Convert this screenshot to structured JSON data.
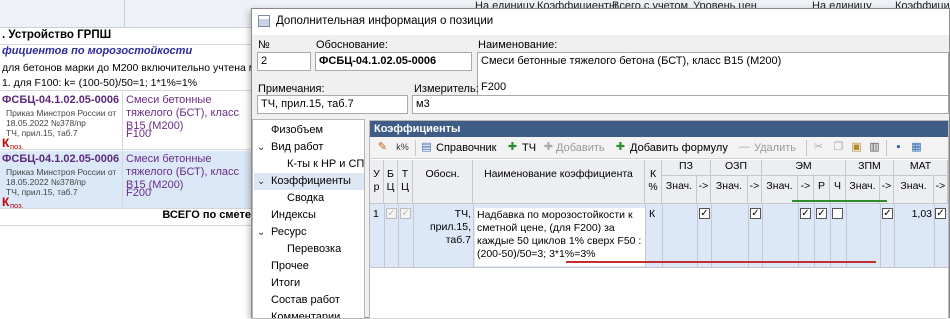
{
  "background": {
    "header_cols": [
      "На единицу",
      "Коэффициенты",
      "Всего с учетом",
      "Уровень цен",
      "На единицу",
      "Коэффициенты"
    ],
    "section_title": ". Устройство ГРПШ",
    "subsection_title": "фициентов по морозостойкости",
    "note_line1": "для бетонов марки до М200 включительно учтена мор",
    "note_line2": "1. для F100: k= (100-50)/50=1; 1*1%=1%",
    "positions": [
      {
        "code": "ФСБЦ-04.1.02.05-0006",
        "order": "Приказ Минстроя России от 18.05.2022 №378/пр",
        "tch": "ТЧ, прил.15, таб.7",
        "k": "К",
        "kpoz": "поз.",
        "name": "Смеси бетонные тяжелого (БСТ), класс B15 (М200)",
        "frost": "F100"
      },
      {
        "code": "ФСБЦ-04.1.02.05-0006",
        "order": "Приказ Минстроя России от 18.05.2022 №378/пр",
        "tch": "ТЧ, прил.15, таб.7",
        "k": "К",
        "kpoz": "поз.",
        "name": "Смеси бетонные тяжелого (БСТ), класс B15 (М200)",
        "frost": "F200"
      }
    ],
    "total_label": "ВСЕГО по смете"
  },
  "dialog": {
    "title": "Дополнительная информация о позиции",
    "number_label": "№",
    "number_value": "2",
    "basis_label": "Обоснование:",
    "basis_value": "ФСБЦ-04.1.02.05-0006",
    "name_label": "Наименование:",
    "name_value": "Смеси бетонные тяжелого бетона (БСТ), класс B15 (М200)",
    "name_value2": "F200",
    "notes_label": "Примечания:",
    "notes_value": "ТЧ, прил.15, таб.7",
    "unit_label": "Измеритель:",
    "unit_value": "м3",
    "tree": [
      {
        "label": "Физобъем",
        "indent": 1,
        "chev": ""
      },
      {
        "label": "Вид работ",
        "indent": 1,
        "chev": "⌄"
      },
      {
        "label": "К-ты к НР и СП",
        "indent": 2,
        "chev": ""
      },
      {
        "label": "Коэффициенты",
        "indent": 1,
        "chev": "⌄",
        "selected": true
      },
      {
        "label": "Сводка",
        "indent": 2,
        "chev": ""
      },
      {
        "label": "Индексы",
        "indent": 1,
        "chev": ""
      },
      {
        "label": "Ресурс",
        "indent": 1,
        "chev": "⌄"
      },
      {
        "label": "Перевозка",
        "indent": 2,
        "chev": ""
      },
      {
        "label": "Прочее",
        "indent": 1,
        "chev": ""
      },
      {
        "label": "Итоги",
        "indent": 1,
        "chev": ""
      },
      {
        "label": "Состав работ",
        "indent": 1,
        "chev": ""
      },
      {
        "label": "Комментарии",
        "indent": 1,
        "chev": ""
      }
    ],
    "panel_title": "Коэффициенты",
    "toolbar": {
      "ref": "Справочник",
      "tch": "ТЧ",
      "add": "Добавить",
      "add_formula": "Добавить формулу",
      "delete": "Удалить"
    },
    "grid": {
      "headers": {
        "ur": "У р",
        "b": "Б Ц",
        "t": "Т Ц",
        "basis": "Обосн.",
        "coef_name": "Наименование коэффициента",
        "kpct": "К %",
        "pz": "ПЗ",
        "ozp": "ОЗП",
        "em": "ЭМ",
        "zpm": "ЗПМ",
        "mat": "МАТ",
        "val": "Знач.",
        "arrow": "->",
        "r": "Р",
        "ch": "Ч"
      },
      "row": {
        "ur": "1",
        "basis": "ТЧ, прил.15, таб.7",
        "name": "Надбавка по морозостойкости к сметной цене, (для F200) за каждые 50 циклов 1% сверх F50 : (200-50)/50=3; 3*1%=3%",
        "kpct": "К",
        "mat_value": "1,03"
      }
    }
  }
}
